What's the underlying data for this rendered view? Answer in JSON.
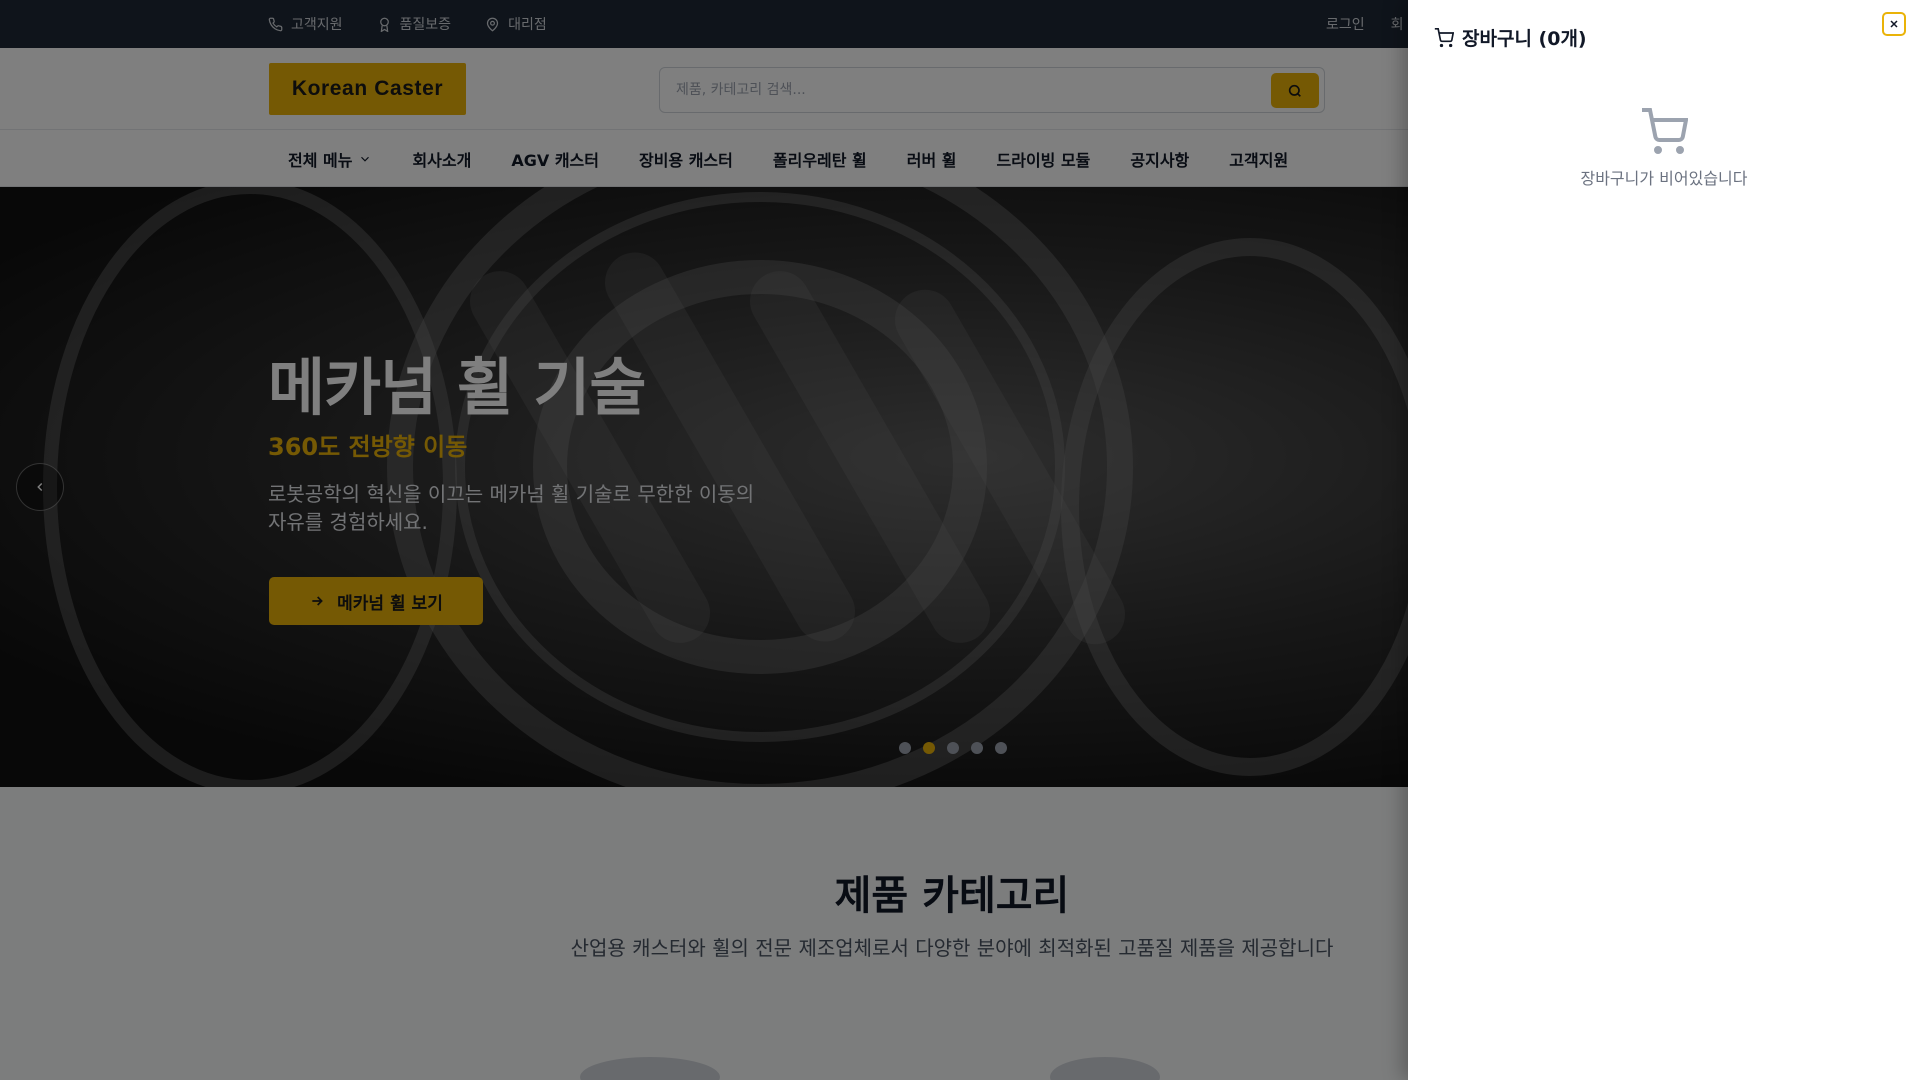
{
  "topbar": {
    "links": [
      {
        "label": "고객지원",
        "icon": "phone-icon"
      },
      {
        "label": "품질보증",
        "icon": "award-icon"
      },
      {
        "label": "대리점",
        "icon": "map-pin-icon"
      }
    ],
    "login": "로그인",
    "signup_partial": "회"
  },
  "header": {
    "logo": "Korean Caster",
    "search_placeholder": "제품, 카테고리 검색..."
  },
  "nav": {
    "items": [
      "전체 메뉴",
      "회사소개",
      "AGV 캐스터",
      "장비용 캐스터",
      "폴리우레탄 휠",
      "러버 휠",
      "드라이빙 모듈",
      "공지사항",
      "고객지원"
    ]
  },
  "hero": {
    "title": "메카넘 휠 기술",
    "subtitle": "360도 전방향 이동",
    "description": "로봇공학의 혁신을 이끄는 메카넘 휠 기술로 무한한 이동의 자유를 경험하세요.",
    "cta": "메카넘 휠 보기",
    "slides": 5,
    "active_slide": 2
  },
  "category": {
    "title": "제품 카테고리",
    "description": "산업용 캐스터와 휠의 전문 제조업체로서 다양한 분야에 최적화된 고품질 제품을 제공합니다"
  },
  "cart": {
    "title": "장바구니 (0개)",
    "empty_message": "장바구니가 비어있습니다"
  },
  "colors": {
    "accent": "#eab308",
    "topbar": "#1f2937",
    "overlay": "rgba(0,0,0,0.5)"
  }
}
